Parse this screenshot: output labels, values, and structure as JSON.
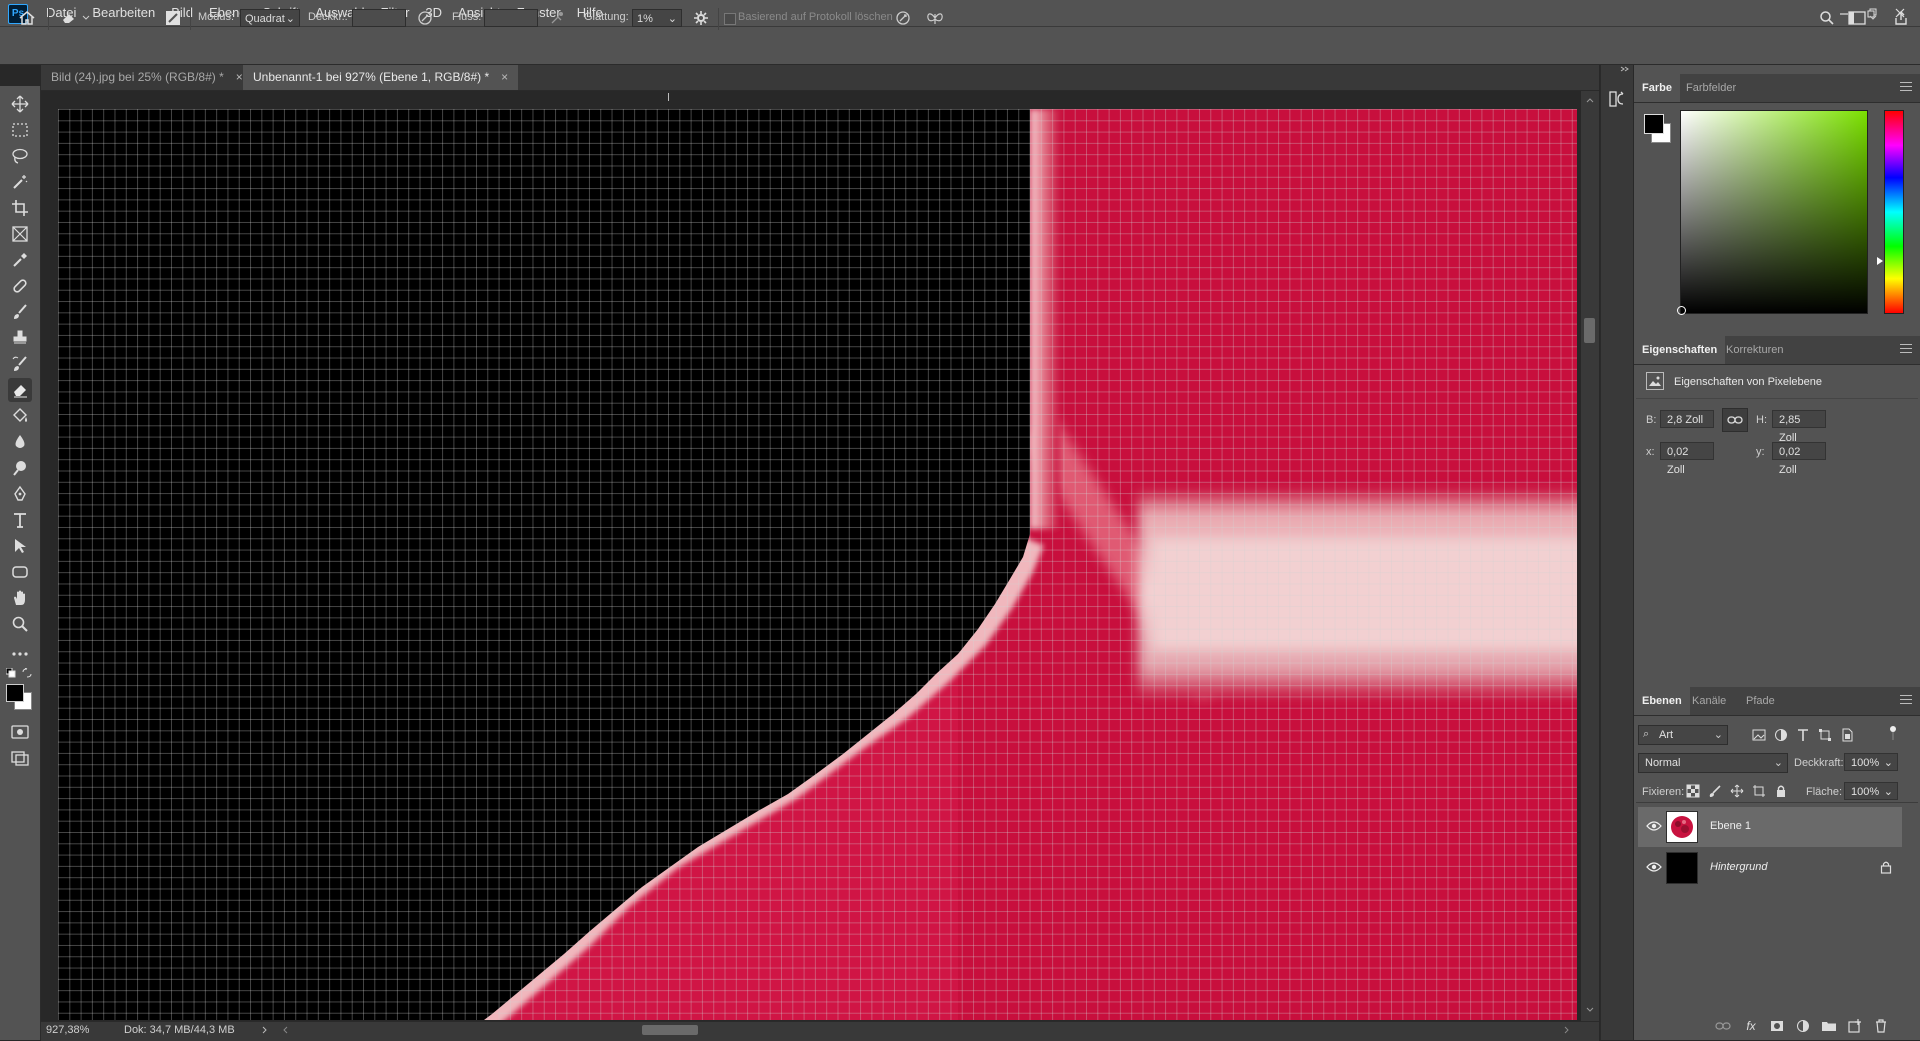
{
  "app": {
    "logo_text": "Ps"
  },
  "menu": [
    "Datei",
    "Bearbeiten",
    "Bild",
    "Ebene",
    "Schrift",
    "Auswahl",
    "Filter",
    "3D",
    "Ansicht",
    "Fenster",
    "Hilfe"
  ],
  "options": {
    "modus_label": "Modus:",
    "modus_value": "Quadrat",
    "deckkr_label": "Deckkr.:",
    "fluss_label": "Fluss:",
    "glaettung_label": "Glättung:",
    "glaettung_value": "1%",
    "protokoll_label": "Basierend auf Protokoll löschen"
  },
  "tabs": [
    {
      "label": "Bild (24).jpg bei 25% (RGB/8#) *",
      "active": false
    },
    {
      "label": "Unbenannt-1 bei 927% (Ebene 1, RGB/8#) *",
      "active": true
    }
  ],
  "status": {
    "zoom": "927,38%",
    "doc": "Dok: 34,7 MB/44,3 MB"
  },
  "color_panel": {
    "tabs": [
      "Farbe",
      "Farbfelder"
    ],
    "foreground": "#000000",
    "background": "#ffffff"
  },
  "properties_panel": {
    "tabs": [
      "Eigenschaften",
      "Korrekturen"
    ],
    "title": "Eigenschaften von Pixelebene",
    "w_label": "B:",
    "w_value": "2,8 Zoll",
    "h_label": "H:",
    "h_value": "2,85 Zoll",
    "x_label": "x:",
    "x_value": "0,02 Zoll",
    "y_label": "y:",
    "y_value": "0,02 Zoll"
  },
  "layers_panel": {
    "tabs": [
      "Ebenen",
      "Kanäle",
      "Pfade"
    ],
    "filter_value": "Art",
    "blend_mode": "Normal",
    "opacity_label": "Deckkraft:",
    "opacity_value": "100%",
    "lock_label": "Fixieren:",
    "fill_label": "Fläche:",
    "fill_value": "100%",
    "layers": [
      {
        "name": "Ebene 1",
        "selected": true,
        "locked": false
      },
      {
        "name": "Hintergrund",
        "selected": false,
        "locked": true
      }
    ]
  },
  "colors": {
    "crimson": "#c8123f",
    "highlight": "#f0c4c6",
    "ui_dark": "#535353"
  }
}
